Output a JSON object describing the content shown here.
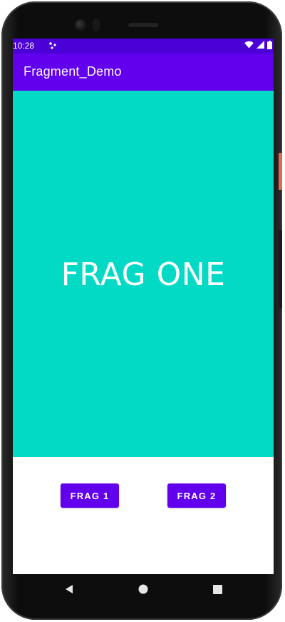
{
  "status_bar": {
    "time": "10:28"
  },
  "app_bar": {
    "title": "Fragment_Demo"
  },
  "fragment": {
    "text": "FRAG ONE"
  },
  "buttons": {
    "frag1_label": "FRAG 1",
    "frag2_label": "FRAG 2"
  },
  "colors": {
    "primary": "#6200ee",
    "primary_dark": "#4b00d6",
    "fragment_bg": "#03dac5"
  },
  "icons": [
    "dots-icon",
    "wifi-icon",
    "signal-icon",
    "battery-icon",
    "back-icon",
    "home-icon",
    "recents-icon"
  ]
}
